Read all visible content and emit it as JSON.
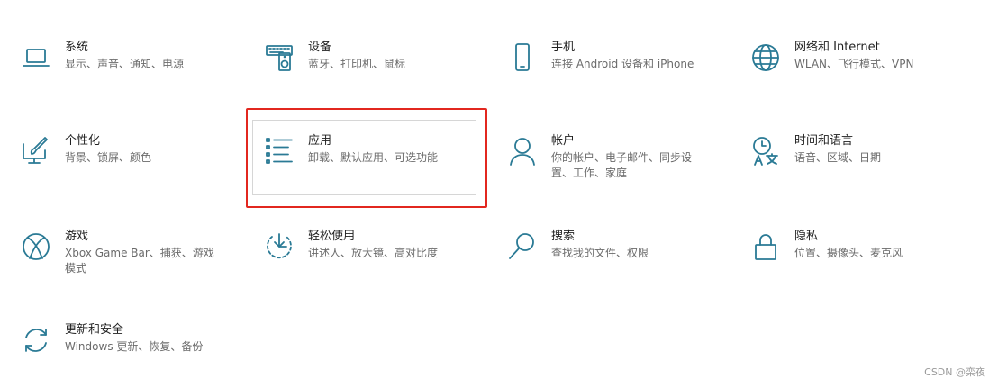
{
  "colors": {
    "accent": "#2a7a95",
    "highlight": "#e2271f"
  },
  "tiles": {
    "system": {
      "title": "系统",
      "desc": "显示、声音、通知、电源",
      "icon": "laptop-icon"
    },
    "devices": {
      "title": "设备",
      "desc": "蓝牙、打印机、鼠标",
      "icon": "keyboard-speaker-icon"
    },
    "phone": {
      "title": "手机",
      "desc": "连接 Android 设备和 iPhone",
      "icon": "phone-icon"
    },
    "network": {
      "title": "网络和 Internet",
      "desc": "WLAN、飞行模式、VPN",
      "icon": "globe-icon"
    },
    "personal": {
      "title": "个性化",
      "desc": "背景、锁屏、颜色",
      "icon": "paint-monitor-icon"
    },
    "apps": {
      "title": "应用",
      "desc": "卸载、默认应用、可选功能",
      "icon": "list-icon"
    },
    "accounts": {
      "title": "帐户",
      "desc": "你的帐户、电子邮件、同步设置、工作、家庭",
      "icon": "person-icon"
    },
    "time": {
      "title": "时间和语言",
      "desc": "语音、区域、日期",
      "icon": "clock-language-icon"
    },
    "gaming": {
      "title": "游戏",
      "desc": "Xbox Game Bar、捕获、游戏模式",
      "icon": "xbox-icon"
    },
    "ease": {
      "title": "轻松使用",
      "desc": "讲述人、放大镜、高对比度",
      "icon": "ease-of-access-icon"
    },
    "search": {
      "title": "搜索",
      "desc": "查找我的文件、权限",
      "icon": "search-icon"
    },
    "privacy": {
      "title": "隐私",
      "desc": "位置、摄像头、麦克风",
      "icon": "lock-icon"
    },
    "update": {
      "title": "更新和安全",
      "desc": "Windows 更新、恢复、备份",
      "icon": "refresh-icon"
    }
  },
  "watermark": "CSDN @栾夜"
}
